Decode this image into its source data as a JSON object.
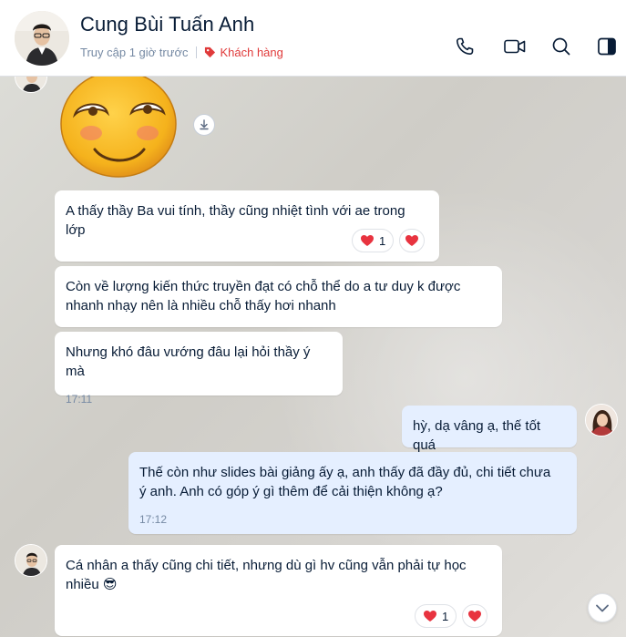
{
  "header": {
    "name": "Cung Bùi Tuấn Anh",
    "last_seen": "Truy cập 1 giờ trước",
    "tag_label": "Khách hàng",
    "tag_color": "#e03a3a",
    "icons": [
      "phone-icon",
      "video-call-icon",
      "search-icon",
      "sidebar-toggle-icon"
    ]
  },
  "messages": [
    {
      "from": "other",
      "type": "sticker",
      "sticker": "smiling-face-sticker"
    },
    {
      "from": "other",
      "text": "A thấy thầy Ba vui tính, thầy cũng nhiệt tình với ae trong lớp",
      "reaction_count": "1"
    },
    {
      "from": "other",
      "text": "Còn về lượng kiến thức truyền đạt có chỗ thể do a tư duy k được nhanh nhạy nên là nhiều chỗ thấy hơi nhanh"
    },
    {
      "from": "other",
      "text": "Nhưng khó đâu vướng đâu lại hỏi thầy ý mà",
      "time": "17:11"
    },
    {
      "from": "me",
      "text": "hỳ, dạ vâng ạ, thế tốt quá"
    },
    {
      "from": "me",
      "text": "Thế còn như slides bài giảng ấy ạ, anh thấy đã đầy đủ, chi tiết chưa ý anh. Anh có góp ý gì thêm để cải thiện không ạ?",
      "time": "17:12"
    },
    {
      "from": "other",
      "text": "Cá nhân a thấy cũng chi tiết, nhưng dù gì hv cũng vẫn phải tự học nhiều",
      "emoji": "😎",
      "reaction_count": "1"
    }
  ],
  "colors": {
    "accent_blue": "#0068ff",
    "my_bubble": "#e5efff",
    "heart_red": "#e8333f"
  }
}
